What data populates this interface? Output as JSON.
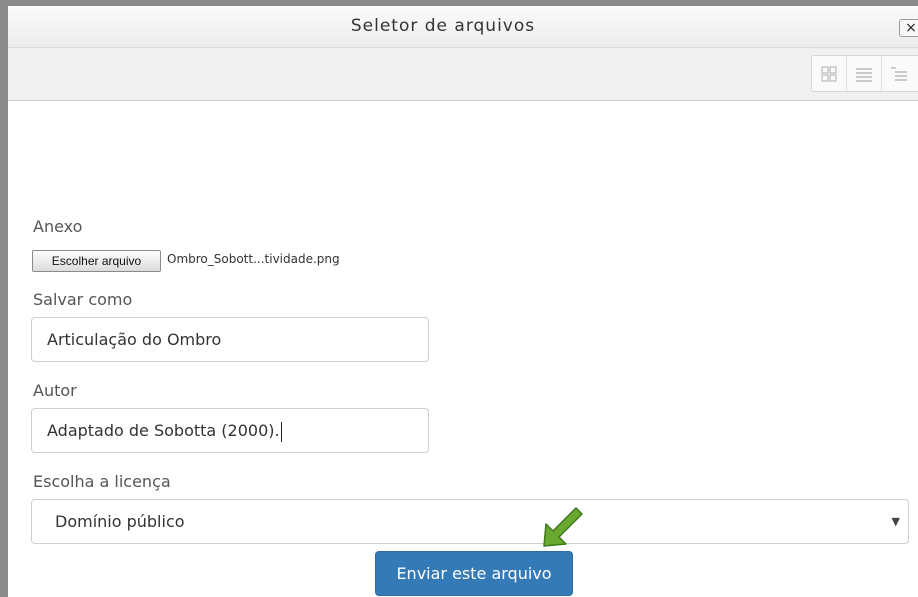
{
  "dialog": {
    "title": "Seletor de arquivos",
    "close_label": "×"
  },
  "toolbar": {
    "view_buttons": [
      "icons-view",
      "details-view",
      "tree-view"
    ]
  },
  "form": {
    "attachment_label": "Anexo",
    "choose_file_button": "Escolher arquivo",
    "chosen_file_name": "Ombro_Sobott...tividade.png",
    "save_as_label": "Salvar como",
    "save_as_value": "Articulação do Ombro",
    "author_label": "Autor",
    "author_value": "Adaptado de Sobotta (2000).",
    "license_label": "Escolha a licença",
    "license_value": "Domínio público",
    "submit_button": "Enviar este arquivo"
  },
  "colors": {
    "primary_button": "#337ab7",
    "annotation_arrow": "#6aa82f"
  }
}
